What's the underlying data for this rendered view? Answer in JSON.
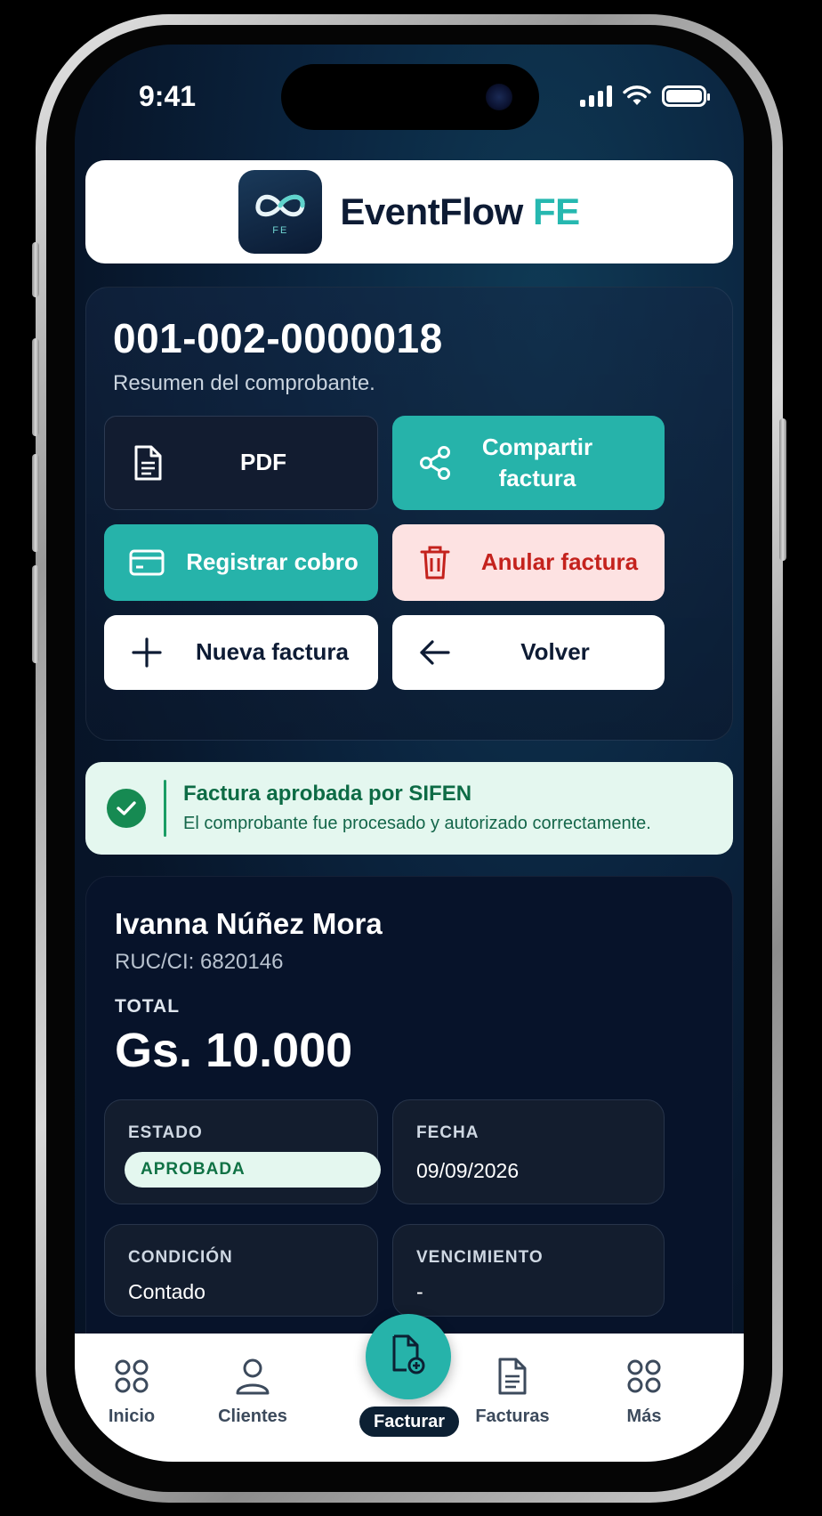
{
  "status_bar": {
    "time": "9:41"
  },
  "brand": {
    "name": "EventFlow",
    "suffix": "FE",
    "logo_tag": "FE"
  },
  "invoice": {
    "number": "001-002-0000018",
    "subtitle": "Resumen del comprobante."
  },
  "actions": {
    "pdf": "PDF",
    "share": "Compartir factura",
    "register_payment": "Registrar cobro",
    "cancel_invoice": "Anular factura",
    "new_invoice": "Nueva factura",
    "back": "Volver"
  },
  "alert": {
    "title": "Factura aprobada por SIFEN",
    "message": "El comprobante fue procesado y autorizado correctamente."
  },
  "client": {
    "name": "Ivanna Núñez Mora",
    "ruc": "RUC/CI: 6820146",
    "total_label": "TOTAL",
    "total_amount": "Gs. 10.000"
  },
  "details": {
    "estado_label": "ESTADO",
    "estado_value": "APROBADA",
    "fecha_label": "FECHA",
    "fecha_value": "09/09/2026",
    "condicion_label": "CONDICIÓN",
    "condicion_value": "Contado",
    "vencimiento_label": "VENCIMIENTO",
    "vencimiento_value": "-"
  },
  "nav": {
    "inicio": "Inicio",
    "clientes": "Clientes",
    "facturar": "Facturar",
    "facturas": "Facturas",
    "mas": "Más"
  },
  "colors": {
    "accent": "#26b3aa",
    "danger": "#c4221d",
    "success": "#168a52",
    "background": "#071529"
  }
}
